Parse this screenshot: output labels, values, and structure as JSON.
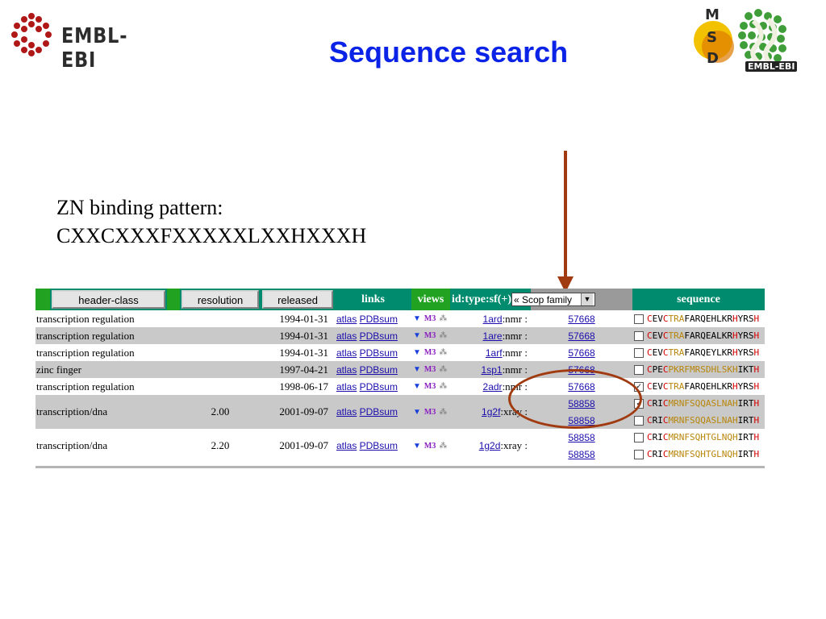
{
  "slide": {
    "title": "Sequence search",
    "pattern_lines": [
      "ZN binding pattern:",
      "CXXCXXXFXXXXXLXXHXXXH"
    ]
  },
  "logos": {
    "ebi_text": "EMBL-EBI",
    "msd_letters": [
      "M",
      "S",
      "D"
    ],
    "msd_ebi_text": "EMBL-EBI"
  },
  "colors": {
    "title": "#0a23e6",
    "header_bg": "#008b6e",
    "annotation": "#a03a10"
  },
  "table": {
    "headers": {
      "header_class": "header-class",
      "resolution": "resolution",
      "released": "released",
      "links": "links",
      "views": "views",
      "id_type": "id:type:sf(+)",
      "scop_select": "« Scop family",
      "sequence": "sequence"
    },
    "rows": [
      {
        "cls": "transcription regulation",
        "res": "",
        "rel": "1994-01-31",
        "id": "1ard",
        "type": ":nmr",
        "sf": [
          "57668"
        ],
        "chk": [
          false
        ],
        "seq": [
          [
            "C",
            "EV",
            "C",
            "TR",
            "A",
            "FARQEHLKR",
            "H",
            "YRS",
            "H"
          ]
        ]
      },
      {
        "cls": "transcription regulation",
        "res": "",
        "rel": "1994-01-31",
        "id": "1are",
        "type": ":nmr",
        "sf": [
          "57668"
        ],
        "chk": [
          false
        ],
        "seq": [
          [
            "C",
            "EV",
            "C",
            "TR",
            "A",
            "FARQEALKR",
            "H",
            "YRS",
            "H"
          ]
        ]
      },
      {
        "cls": "transcription regulation",
        "res": "",
        "rel": "1994-01-31",
        "id": "1arf",
        "type": ":nmr",
        "sf": [
          "57668"
        ],
        "chk": [
          false
        ],
        "seq": [
          [
            "C",
            "EV",
            "C",
            "TR",
            "A",
            "FARQEYLKR",
            "H",
            "YRS",
            "H"
          ]
        ]
      },
      {
        "cls": "zinc finger",
        "res": "",
        "rel": "1997-04-21",
        "id": "1sp1",
        "type": ":nmr",
        "sf": [
          "57668"
        ],
        "chk": [
          false
        ],
        "seq": [
          [
            "C",
            "PE",
            "C",
            "PKRFMRSDHLSK",
            "H",
            "IKT",
            "H"
          ]
        ]
      },
      {
        "cls": "transcription regulation",
        "res": "",
        "rel": "1998-06-17",
        "id": "2adr",
        "type": ":nmr",
        "sf": [
          "57668"
        ],
        "chk": [
          true
        ],
        "seq": [
          [
            "C",
            "EV",
            "C",
            "TR",
            "A",
            "FARQEHLKR",
            "H",
            "YRS",
            "H"
          ]
        ]
      },
      {
        "cls": "transcription/dna",
        "res": "2.00",
        "rel": "2001-09-07",
        "id": "1g2f",
        "type": ":xray",
        "sf": [
          "58858",
          "58858"
        ],
        "chk": [
          true,
          false
        ],
        "seq": [
          [
            "C",
            "RI",
            "C",
            "MRNFSQQASLNA",
            "H",
            "IRT",
            "H"
          ],
          [
            "C",
            "RI",
            "C",
            "MRNFSQQASLNA",
            "H",
            "IRT",
            "H"
          ]
        ]
      },
      {
        "cls": "transcription/dna",
        "res": "2.20",
        "rel": "2001-09-07",
        "id": "1g2d",
        "type": ":xray",
        "sf": [
          "58858",
          "58858"
        ],
        "chk": [
          false,
          false
        ],
        "seq": [
          [
            "C",
            "RI",
            "C",
            "MRNFSQHTGLNQ",
            "H",
            "IRT",
            "H"
          ],
          [
            "C",
            "RI",
            "C",
            "MRNFSQHTGLNQ",
            "H",
            "IRT",
            "H"
          ]
        ]
      }
    ],
    "link_atlas": "atlas",
    "link_pdbsum": "PDBsum",
    "icon_names": [
      "rasmol-icon",
      "msd-icon",
      "molecule-icon"
    ]
  }
}
